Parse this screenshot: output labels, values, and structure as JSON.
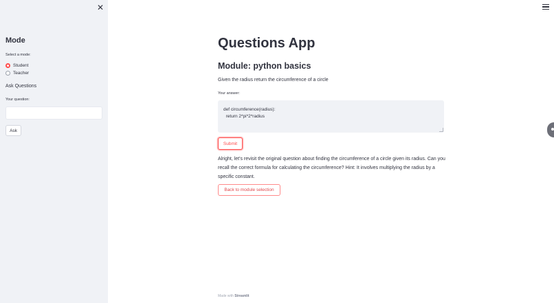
{
  "sidebar": {
    "close_glyph": "✕",
    "heading": "Mode",
    "mode_label": "Select a mode:",
    "modes": [
      {
        "label": "Student",
        "selected": true
      },
      {
        "label": "Teacher",
        "selected": false
      }
    ],
    "ask_heading": "Ask Questions",
    "question_label": "Your question:",
    "question_value": "",
    "ask_button": "Ask"
  },
  "main": {
    "title": "Questions App",
    "module_title": "Module: python basics",
    "question": "Given the radius return the circumference of a circle",
    "answer_label": "Your answer:",
    "answer_value": "def circumference(radius):\n  return 2*pi*2*radius",
    "submit_button": "Submit",
    "feedback": "Alright, let's revisit the original question about finding the circumference of a circle given its radius. Can you recall the correct formula for calculating the circumference? Hint: It involves multiplying the radius by a specific constant.",
    "back_button": "Back to module selection"
  },
  "footer": {
    "made_with": "Made with",
    "brand": "Streamlit"
  },
  "icons": {
    "menu": "hamburger-menu-icon",
    "close": "close-icon"
  },
  "colors": {
    "accent": "#ff4b4b",
    "sidebar_bg": "#f0f2f6",
    "text": "#31333f"
  }
}
